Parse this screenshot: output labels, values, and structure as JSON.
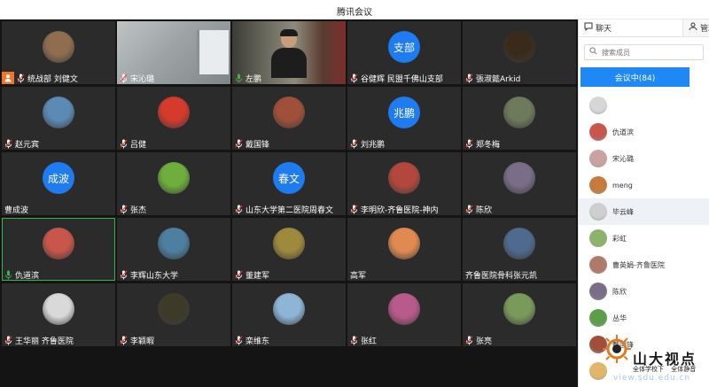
{
  "window": {
    "title": "腾讯会议"
  },
  "participants": [
    {
      "name": "统战部 刘健文",
      "avatar": "img",
      "color": "#8f6d4e",
      "host": true
    },
    {
      "name": "宋沁璐",
      "avatar": "camera"
    },
    {
      "name": "左鹏",
      "avatar": "camera-person",
      "speaking": true
    },
    {
      "name": "谷健辉 民盟千佛山支部",
      "avatar": "text",
      "text": "支部"
    },
    {
      "name": "張淑懿Arkid",
      "avatar": "img",
      "color": "#3a2a1c"
    },
    {
      "name": "赵元宾",
      "avatar": "img",
      "color": "#5b8bb5"
    },
    {
      "name": "吕健",
      "avatar": "img",
      "color": "#d63a2b"
    },
    {
      "name": "戴国锋",
      "avatar": "img",
      "color": "#a0503a"
    },
    {
      "name": "刘兆鹏",
      "avatar": "text",
      "text": "兆鹏"
    },
    {
      "name": "郑冬梅",
      "avatar": "img",
      "color": "#6d7a5c"
    },
    {
      "name": "曹成波",
      "avatar": "text",
      "text": "成波",
      "nomic": true
    },
    {
      "name": "张杰",
      "avatar": "img",
      "color": "#6fae3c"
    },
    {
      "name": "山东大学第二医院周春文",
      "avatar": "text",
      "text": "春文"
    },
    {
      "name": "李明欣-齐鲁医院-神内",
      "avatar": "img",
      "color": "#b3473e"
    },
    {
      "name": "陈欣",
      "avatar": "img",
      "color": "#7a6d88"
    },
    {
      "name": "仇道滨",
      "avatar": "img",
      "color": "#c8564a",
      "active": true,
      "speaking": true
    },
    {
      "name": "李辉山东大学",
      "avatar": "img",
      "color": "#4d7fa0"
    },
    {
      "name": "董建军",
      "avatar": "img",
      "color": "#9e8a3d"
    },
    {
      "name": "高军",
      "avatar": "img",
      "color": "#e08a52",
      "nomic": true
    },
    {
      "name": "齐鲁医院骨科张元凯",
      "avatar": "img",
      "color": "#4f6a8f",
      "nomic": true
    },
    {
      "name": "王华丽 齐鲁医院",
      "avatar": "img",
      "color": "#d9d9d9"
    },
    {
      "name": "李颖暇",
      "avatar": "img",
      "color": "#3e3a2a"
    },
    {
      "name": "栾维东",
      "avatar": "img",
      "color": "#8eb4d6"
    },
    {
      "name": "张红",
      "avatar": "img",
      "color": "#b85b8c"
    },
    {
      "name": "张亮",
      "avatar": "img",
      "color": "#7a9a5c"
    }
  ],
  "panel": {
    "tabs": [
      "聊天",
      "管理"
    ],
    "search_placeholder": "搜索成员",
    "in_meeting_label": "会议中(84)",
    "members": [
      {
        "name": "",
        "color": "#d6d6d6"
      },
      {
        "name": "仇道滨",
        "color": "#c8564a"
      },
      {
        "name": "宋沁璐",
        "color": "#c9a3a0"
      },
      {
        "name": "meng",
        "color": "#c77a3c"
      },
      {
        "name": "毕云峰",
        "color": "#cfcfcf",
        "highlight": true
      },
      {
        "name": "彩虹",
        "color": "#8db36a"
      },
      {
        "name": "曹英娟-齐鲁医院",
        "color": "#b07a6a"
      },
      {
        "name": "陈欣",
        "color": "#7a6d88"
      },
      {
        "name": "丛华",
        "color": "#5d9e4a"
      },
      {
        "name": "戴国锋",
        "color": "#a0503a"
      },
      {
        "name": "",
        "color": "#e0b66a"
      }
    ]
  },
  "watermark": {
    "title": "山大视点",
    "sub1": "全体学校下",
    "sub2": "全体静音",
    "url": "view.sdu.edu.cn"
  }
}
